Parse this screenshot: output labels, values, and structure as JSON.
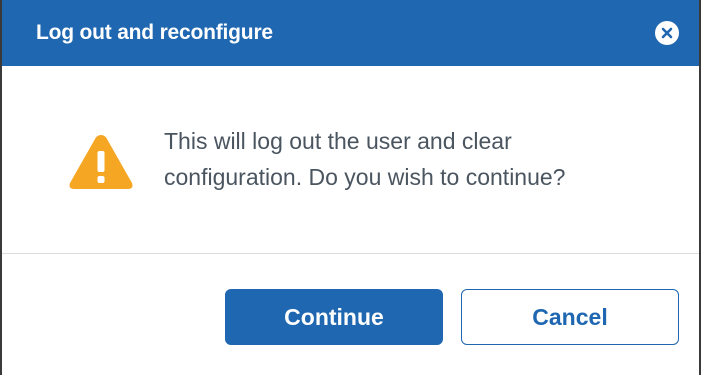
{
  "dialog": {
    "title": "Log out and reconfigure",
    "close_icon": "close-circle-icon",
    "warning_icon": "warning-triangle-icon",
    "message": "This will log out the user and clear configuration. Do you wish to continue?",
    "buttons": {
      "continue_label": "Continue",
      "cancel_label": "Cancel"
    }
  },
  "colors": {
    "header_bg": "#1f67b1",
    "primary": "#1f67b1",
    "warning": "#f5a623",
    "text": "#4a5560"
  }
}
